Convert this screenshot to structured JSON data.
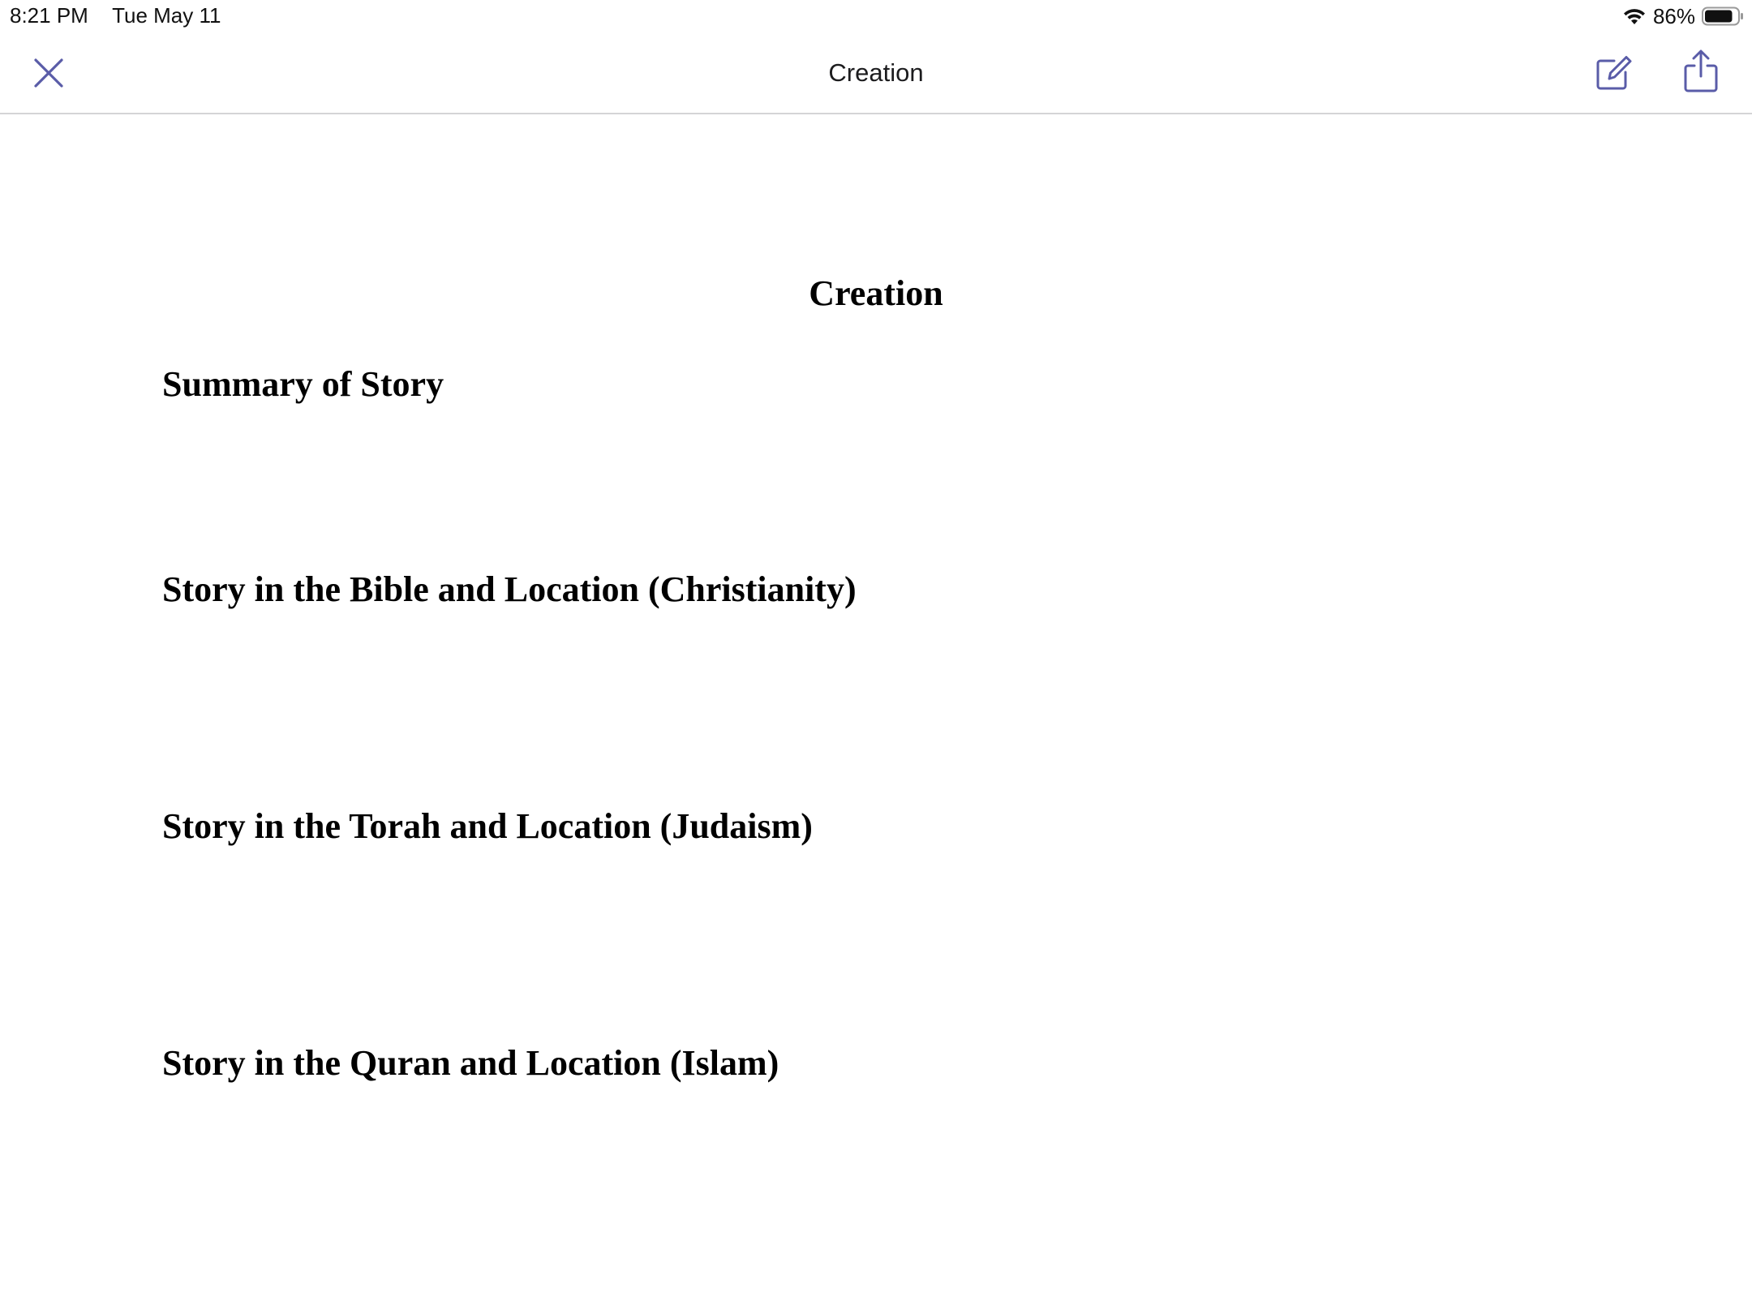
{
  "status_bar": {
    "time": "8:21 PM",
    "date": "Tue May 11",
    "battery_percent": "86%",
    "battery_level": 0.86
  },
  "nav": {
    "title": "Creation",
    "icons": [
      "close-icon",
      "edit-icon",
      "share-icon"
    ],
    "accent_color": "#5a5ca8"
  },
  "document": {
    "title": "Creation",
    "headings": [
      "Summary of Story",
      "Story in the Bible and Location (Christianity)",
      "Story in the Torah and Location (Judaism)",
      "Story in the Quran and Location (Islam)"
    ]
  }
}
